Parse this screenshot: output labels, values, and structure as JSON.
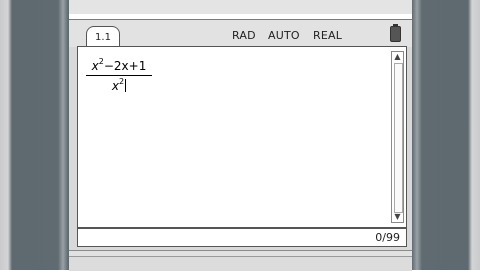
{
  "tab": {
    "label": "1.1"
  },
  "status": {
    "angle_mode": "RAD",
    "calc_mode": "AUTO",
    "real_mode": "REAL",
    "battery_icon": "battery-icon"
  },
  "expression": {
    "numerator": {
      "x": "x",
      "exp1": "2",
      "rest": "−2x+1"
    },
    "denominator": {
      "x": "x",
      "exp": "2"
    }
  },
  "footer": {
    "history_count": "0/99"
  },
  "icons": {
    "scroll_up": "▲",
    "scroll_down": "▼"
  }
}
